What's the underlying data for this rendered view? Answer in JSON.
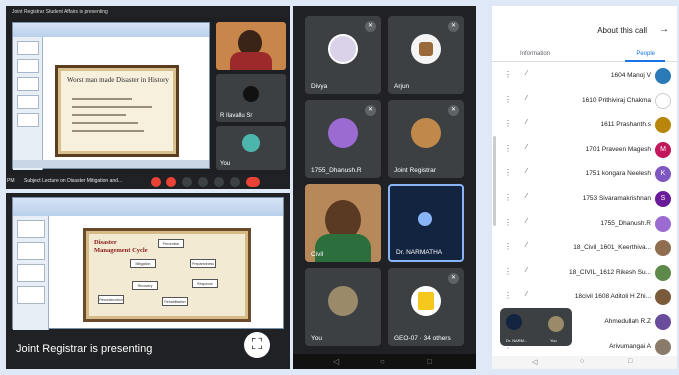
{
  "colors": {
    "meet_dark": "#202124",
    "tile_gray": "#3c4043",
    "accent_blue": "#1a73e8",
    "end_call_red": "#ea4335"
  },
  "top_meet": {
    "topbar_text": "Joint Registrar Student Affairs is presenting",
    "slide_title": "Worst man made Disaster in History",
    "tiles": [
      {
        "name": ""
      },
      {
        "name": "R Ilavallu Sr"
      },
      {
        "name": "You"
      }
    ],
    "caption": "Subject Lecture on Disaster Mitigation and...",
    "time": "PM"
  },
  "bottom_meet": {
    "slide_title": "Disaster Management Cycle",
    "cycle_boxes": [
      "Prevention",
      "Mitigation",
      "Preparedness",
      "Response",
      "Recovery",
      "Rehabilitation",
      "Reconstruction"
    ],
    "banner": "Joint Registrar is presenting"
  },
  "phone_grid": {
    "tiles": [
      {
        "name": "Divya",
        "avatar_color": "#d9d2e9"
      },
      {
        "name": "Arjun",
        "avatar_color": "#f4f4f4"
      },
      {
        "name": "1755_Dhanush.R",
        "avatar_color": "#9c6bd1"
      },
      {
        "name": "Joint Registrar",
        "avatar_color": "#c0894a"
      },
      {
        "name": "Civil",
        "avatar_color": "#c9a070"
      },
      {
        "name": "Dr. NARMATHA",
        "avatar_color": "#1b2a4a"
      },
      {
        "name": "You",
        "avatar_color": "#9a8a6a"
      },
      {
        "name": "GEO-07 · 34 others",
        "avatar_color": "#f6c71c"
      }
    ],
    "nav": [
      "◁",
      "○",
      "□"
    ]
  },
  "people_panel": {
    "title": "About this call",
    "tabs": {
      "information": "Information",
      "people": "People"
    },
    "people": [
      {
        "name": "1604 Manoj V",
        "color": "#2a7ab8",
        "initial": ""
      },
      {
        "name": "1610 Prithiviraj Chakma",
        "color": "#ffffff",
        "initial": ""
      },
      {
        "name": "1611 Prashanth.s",
        "color": "#b8860b",
        "initial": ""
      },
      {
        "name": "1701 Praveen Magesh",
        "color": "#c2185b",
        "initial": "M"
      },
      {
        "name": "1751 kongara Neelesh",
        "color": "#7e57c2",
        "initial": "K"
      },
      {
        "name": "1753 Sivaramakrishnan",
        "color": "#6a1b9a",
        "initial": "S"
      },
      {
        "name": "1755_Dhanush.R",
        "color": "#9c6bd1",
        "initial": ""
      },
      {
        "name": "18_Civil_1601_Keerthiva...",
        "color": "#8e6e4e",
        "initial": ""
      },
      {
        "name": "18_CIVIL_1612 Rikesh Su...",
        "color": "#5d8a4a",
        "initial": ""
      },
      {
        "name": "18civil 1608 Aditoli H Zhi...",
        "color": "#7a5a3a",
        "initial": ""
      },
      {
        "name": "Ahmedullah R.Z",
        "color": "#6a4c9c",
        "initial": ""
      },
      {
        "name": "Arivumangai A",
        "color": "#8a7a6a",
        "initial": ""
      }
    ],
    "pip": {
      "left_name": "Dr. NARM...",
      "right_name": "You"
    },
    "nav": [
      "◁",
      "○",
      "□"
    ]
  }
}
